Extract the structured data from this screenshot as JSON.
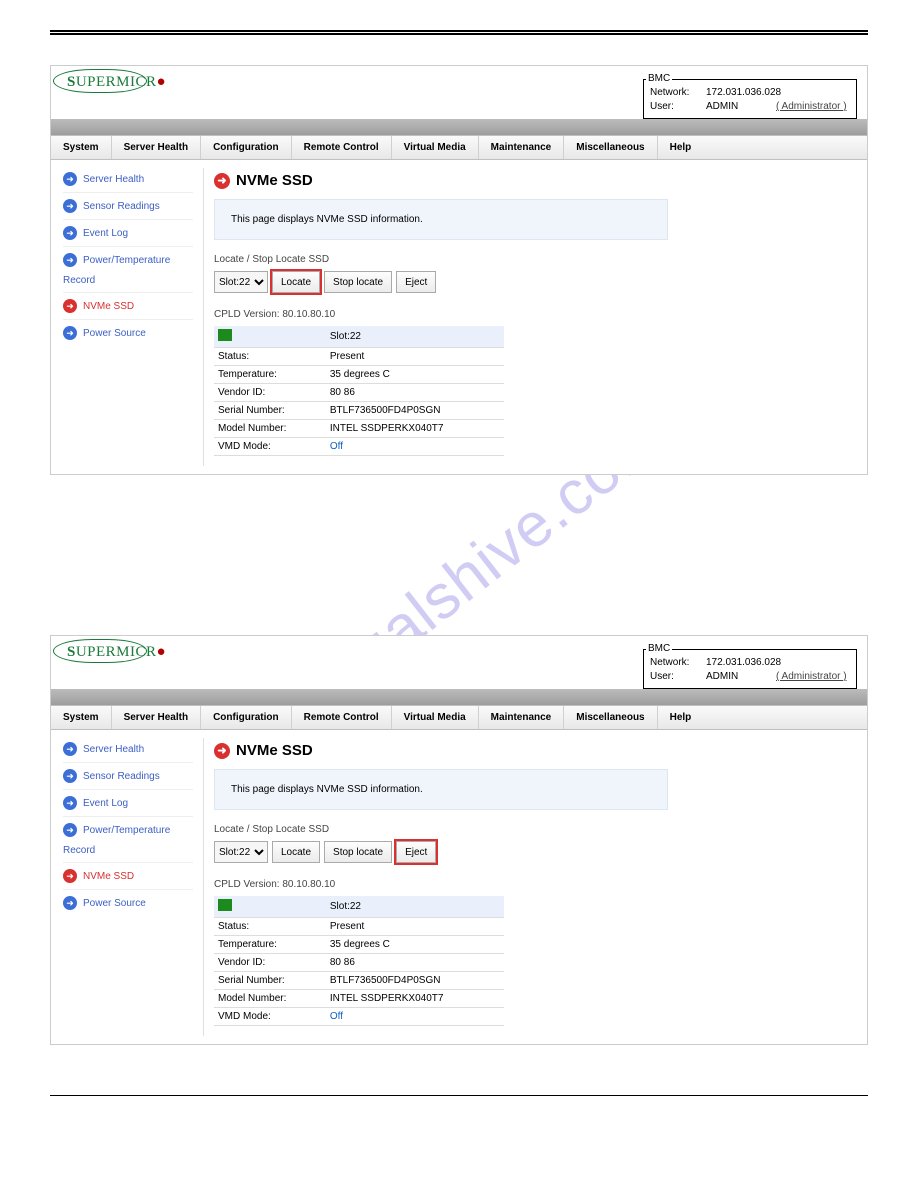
{
  "watermark": "manualshive.com",
  "header": {
    "logo_part1": "S",
    "logo_part2": "UPERMICR",
    "logo_dot": "●",
    "bmc_legend": "BMC",
    "lab_network": "Network:",
    "val_network": "172.031.036.028",
    "lab_user": "User:",
    "val_user": "ADMIN",
    "val_role": "( Administrator )"
  },
  "menu": [
    "System",
    "Server Health",
    "Configuration",
    "Remote Control",
    "Virtual Media",
    "Maintenance",
    "Miscellaneous",
    "Help"
  ],
  "sidebar": {
    "items": [
      {
        "label": "Server Health",
        "active": false
      },
      {
        "label": "Sensor Readings",
        "active": false
      },
      {
        "label": "Event Log",
        "active": false
      },
      {
        "label": "Power/Temperature",
        "active": false,
        "continues": true
      },
      {
        "label": "NVMe SSD",
        "active": true
      },
      {
        "label": "Power Source",
        "active": false
      }
    ],
    "record_label": "Record"
  },
  "content": {
    "title": "NVMe SSD",
    "info": "This page displays NVMe SSD information.",
    "section_label": "Locate / Stop Locate SSD",
    "slot_option": "Slot:22",
    "btn_locate": "Locate",
    "btn_stop": "Stop locate",
    "btn_eject": "Eject",
    "cpld_label": "CPLD Version: 80.10.80.10",
    "table": {
      "slot_label": "Slot:22",
      "rows": [
        {
          "k": "Status:",
          "v": "Present"
        },
        {
          "k": "Temperature:",
          "v": "35 degrees C"
        },
        {
          "k": "Vendor ID:",
          "v": "80 86"
        },
        {
          "k": "Serial Number:",
          "v": "BTLF736500FD4P0SGN"
        },
        {
          "k": "Model Number:",
          "v": "INTEL SSDPERKX040T7"
        },
        {
          "k": "VMD Mode:",
          "v": "Off",
          "link": true
        }
      ]
    }
  },
  "highlights": {
    "panel1": "locate",
    "panel2": "eject"
  }
}
